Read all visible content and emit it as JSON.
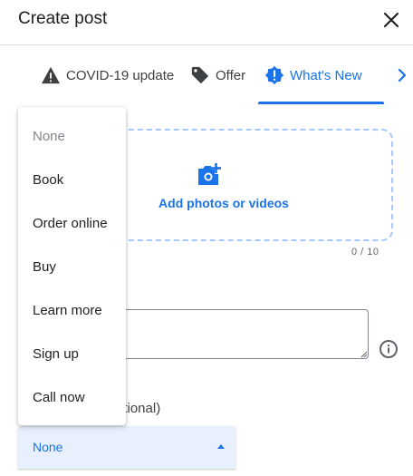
{
  "header": {
    "title": "Create post",
    "close_icon": "close-icon"
  },
  "tabs": [
    {
      "label": "COVID-19 update",
      "icon": "warning-icon"
    },
    {
      "label": "Offer",
      "icon": "tag-icon"
    },
    {
      "label": "What's New",
      "icon": "alert-badge-icon",
      "active": true
    }
  ],
  "tabs_next_icon": "chevron-right-icon",
  "upload": {
    "label": "Add photos or videos",
    "icon": "add-photo-icon",
    "counter": "0 / 10"
  },
  "description": {
    "placeholder_visible": "t"
  },
  "button_field": {
    "label_visible": "ptional)",
    "selected": "None"
  },
  "dropdown": {
    "items": [
      {
        "label": "None",
        "disabled": true
      },
      {
        "label": "Book"
      },
      {
        "label": "Order online"
      },
      {
        "label": "Buy"
      },
      {
        "label": "Learn more"
      },
      {
        "label": "Sign up"
      },
      {
        "label": "Call now"
      }
    ]
  },
  "colors": {
    "accent": "#1a73e8",
    "select_bg": "#e8f0fe",
    "dashed_border": "#a8c7fa"
  }
}
